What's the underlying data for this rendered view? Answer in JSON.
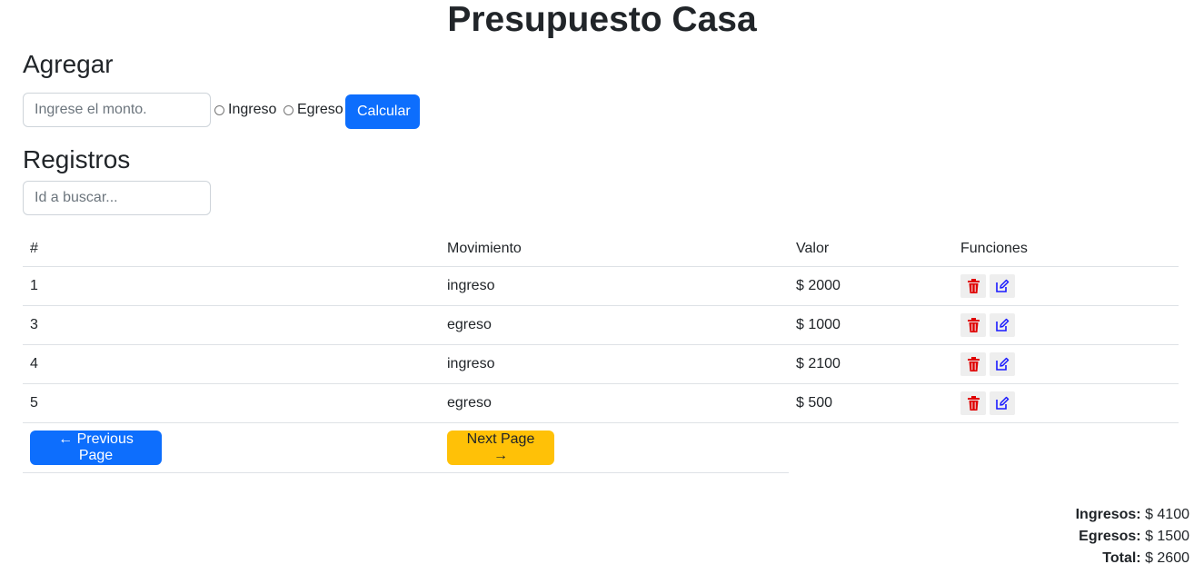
{
  "page": {
    "title": "Presupuesto Casa"
  },
  "add": {
    "heading": "Agregar",
    "amount_placeholder": "Ingrese el monto.",
    "income_label": "Ingreso",
    "expense_label": "Egreso",
    "calculate_label": "Calcular"
  },
  "records": {
    "heading": "Registros",
    "search_placeholder": "Id a buscar...",
    "columns": [
      "#",
      "Movimiento",
      "Valor",
      "Funciones"
    ],
    "rows": [
      {
        "id": "1",
        "movement": "ingreso",
        "value": "$ 2000"
      },
      {
        "id": "3",
        "movement": "egreso",
        "value": "$ 1000"
      },
      {
        "id": "4",
        "movement": "ingreso",
        "value": "$ 2100"
      },
      {
        "id": "5",
        "movement": "egreso",
        "value": "$ 500"
      }
    ],
    "prev_label": "← Previous Page",
    "next_label": "Next Page →"
  },
  "totals": {
    "income_label": "Ingresos:",
    "income_value": "$ 4100",
    "expense_label": "Egresos:",
    "expense_value": "$ 1500",
    "total_label": "Total:",
    "total_value": "$ 2600"
  },
  "icons": {
    "delete": "trash-icon",
    "edit": "edit-icon"
  },
  "colors": {
    "primary": "#0d6efd",
    "warning": "#ffc107",
    "delete": "#e00000",
    "edit": "#1a1aff"
  }
}
